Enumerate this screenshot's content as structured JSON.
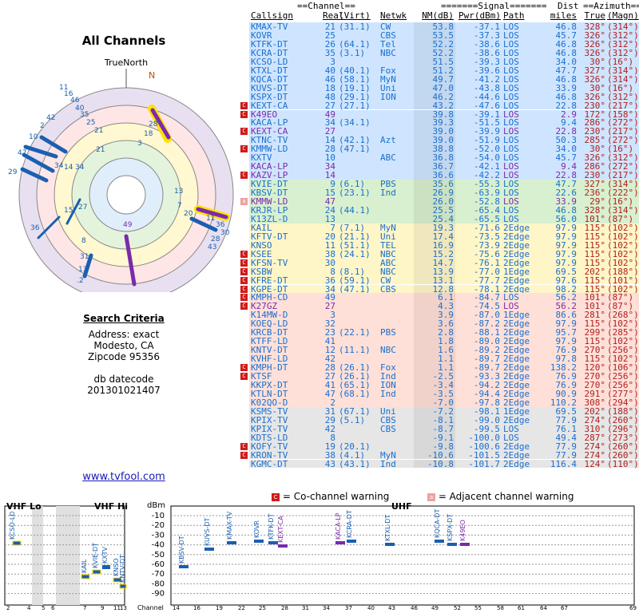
{
  "left": {
    "title": "All Channels",
    "north_label": "TrueNorth",
    "north_marker": "N"
  },
  "criteria": {
    "heading": "Search Criteria",
    "address": "Address: exact",
    "city": "Modesto, CA",
    "zip": "Zipcode 95356",
    "db_label": "db datecode",
    "db_value": "201301021407"
  },
  "site_link": "www.tvfool.com",
  "table": {
    "group_channel": "==Channel==",
    "group_signal": "=======Signal=======",
    "group_dist": "Dist",
    "group_azimuth": "==Azimuth==",
    "headers": [
      "Callsign",
      "Real",
      "(Virt)",
      "Netwk",
      "NM(dB)",
      "Pwr(dBm)",
      "Path",
      "miles",
      "True",
      "(Magn)"
    ],
    "rows": [
      {
        "cs": "KMAX-TV",
        "real": "21",
        "virt": "(31.1)",
        "net": "CW",
        "nm": "53.8",
        "pwr": "-37.1",
        "path": "LOS",
        "dist": "46.8",
        "az": "328°",
        "mag": "(314°)",
        "bg": "#cfe5ff",
        "col": "#1a6fcf",
        "w": ""
      },
      {
        "cs": "KOVR",
        "real": "25",
        "virt": "",
        "net": "CBS",
        "nm": "53.5",
        "pwr": "-37.3",
        "path": "LOS",
        "dist": "45.7",
        "az": "326°",
        "mag": "(312°)",
        "bg": "#cfe5ff",
        "col": "#1a6fcf",
        "w": ""
      },
      {
        "cs": "KTFK-DT",
        "real": "26",
        "virt": "(64.1)",
        "net": "Tel",
        "nm": "52.2",
        "pwr": "-38.6",
        "path": "LOS",
        "dist": "46.8",
        "az": "326°",
        "mag": "(312°)",
        "bg": "#cfe5ff",
        "col": "#1a6fcf",
        "w": ""
      },
      {
        "cs": "KCRA-DT",
        "real": "35",
        "virt": "(3.1)",
        "net": "NBC",
        "nm": "52.2",
        "pwr": "-38.6",
        "path": "LOS",
        "dist": "46.8",
        "az": "326°",
        "mag": "(312°)",
        "bg": "#cfe5ff",
        "col": "#1a6fcf",
        "w": ""
      },
      {
        "cs": "KCSO-LD",
        "real": "3",
        "virt": "",
        "net": "",
        "nm": "51.5",
        "pwr": "-39.3",
        "path": "LOS",
        "dist": "34.0",
        "az": "30°",
        "mag": "(16°)",
        "bg": "#cfe5ff",
        "col": "#1a6fcf",
        "w": ""
      },
      {
        "cs": "KTXL-DT",
        "real": "40",
        "virt": "(40.1)",
        "net": "Fox",
        "nm": "51.2",
        "pwr": "-39.6",
        "path": "LOS",
        "dist": "47.7",
        "az": "327°",
        "mag": "(314°)",
        "bg": "#cfe5ff",
        "col": "#1a6fcf",
        "w": ""
      },
      {
        "cs": "KQCA-DT",
        "real": "46",
        "virt": "(58.1)",
        "net": "MyN",
        "nm": "49.7",
        "pwr": "-41.2",
        "path": "LOS",
        "dist": "46.8",
        "az": "326°",
        "mag": "(314°)",
        "bg": "#cfe5ff",
        "col": "#1a6fcf",
        "w": ""
      },
      {
        "cs": "KUVS-DT",
        "real": "18",
        "virt": "(19.1)",
        "net": "Uni",
        "nm": "47.0",
        "pwr": "-43.8",
        "path": "LOS",
        "dist": "33.9",
        "az": "30°",
        "mag": "(16°)",
        "bg": "#cfe5ff",
        "col": "#1a6fcf",
        "w": ""
      },
      {
        "cs": "KSPX-DT",
        "real": "48",
        "virt": "(29.1)",
        "net": "ION",
        "nm": "46.2",
        "pwr": "-44.6",
        "path": "LOS",
        "dist": "46.8",
        "az": "326°",
        "mag": "(312°)",
        "bg": "#cfe5ff",
        "col": "#1a6fcf",
        "w": ""
      },
      {
        "cs": "KEXT-CA",
        "real": "27",
        "virt": "(27.1)",
        "net": "",
        "nm": "43.2",
        "pwr": "-47.6",
        "path": "LOS",
        "dist": "22.8",
        "az": "230°",
        "mag": "(217°)",
        "bg": "#cfe5ff",
        "col": "#1a6fcf",
        "w": "C"
      },
      {
        "cs": "K49EO",
        "real": "49",
        "virt": "",
        "net": "",
        "nm": "39.8",
        "pwr": "-39.1",
        "path": "LOS",
        "dist": "2.9",
        "az": "172°",
        "mag": "(158°)",
        "bg": "#cfe5ff",
        "col": "#7a2aaa",
        "w": "C"
      },
      {
        "cs": "KACA-LP",
        "real": "34",
        "virt": "(34.1)",
        "net": "",
        "nm": "39.3",
        "pwr": "-51.5",
        "path": "LOS",
        "dist": "9.4",
        "az": "286°",
        "mag": "(272°)",
        "bg": "#cfe5ff",
        "col": "#1a6fcf",
        "w": ""
      },
      {
        "cs": "KEXT-CA",
        "real": "27",
        "virt": "",
        "net": "",
        "nm": "39.0",
        "pwr": "-39.9",
        "path": "LOS",
        "dist": "22.8",
        "az": "230°",
        "mag": "(217°)",
        "bg": "#cfe5ff",
        "col": "#7a2aaa",
        "w": "C"
      },
      {
        "cs": "KTNC-TV",
        "real": "14",
        "virt": "(42.1)",
        "net": "Azt",
        "nm": "39.0",
        "pwr": "-51.9",
        "path": "LOS",
        "dist": "50.3",
        "az": "285°",
        "mag": "(272°)",
        "bg": "#cfe5ff",
        "col": "#1a6fcf",
        "w": ""
      },
      {
        "cs": "KMMW-LD",
        "real": "28",
        "virt": "(47.1)",
        "net": "",
        "nm": "38.8",
        "pwr": "-52.0",
        "path": "LOS",
        "dist": "34.0",
        "az": "30°",
        "mag": "(16°)",
        "bg": "#cfe5ff",
        "col": "#1a6fcf",
        "w": "C"
      },
      {
        "cs": "KXTV",
        "real": "10",
        "virt": "",
        "net": "ABC",
        "nm": "36.8",
        "pwr": "-54.0",
        "path": "LOS",
        "dist": "45.7",
        "az": "326°",
        "mag": "(312°)",
        "bg": "#cfe5ff",
        "col": "#1a6fcf",
        "w": ""
      },
      {
        "cs": "KACA-LP",
        "real": "34",
        "virt": "",
        "net": "",
        "nm": "36.7",
        "pwr": "-42.1",
        "path": "LOS",
        "dist": "9.4",
        "az": "286°",
        "mag": "(272°)",
        "bg": "#cfe5ff",
        "col": "#7a2aaa",
        "w": ""
      },
      {
        "cs": "KAZV-LP",
        "real": "14",
        "virt": "",
        "net": "",
        "nm": "36.6",
        "pwr": "-42.2",
        "path": "LOS",
        "dist": "22.8",
        "az": "230°",
        "mag": "(217°)",
        "bg": "#cfe5ff",
        "col": "#7a2aaa",
        "w": "C"
      },
      {
        "cs": "KVIE-DT",
        "real": "9",
        "virt": "(6.1)",
        "net": "PBS",
        "nm": "35.6",
        "pwr": "-55.3",
        "path": "LOS",
        "dist": "47.7",
        "az": "327°",
        "mag": "(314°)",
        "bg": "#d8f0cf",
        "col": "#1a6fcf",
        "w": ""
      },
      {
        "cs": "KBSV-DT",
        "real": "15",
        "virt": "(23.1)",
        "net": "Ind",
        "nm": "26.9",
        "pwr": "-63.9",
        "path": "LOS",
        "dist": "22.6",
        "az": "236°",
        "mag": "(222°)",
        "bg": "#d8f0cf",
        "col": "#1a6fcf",
        "w": ""
      },
      {
        "cs": "KMMW-LD",
        "real": "47",
        "virt": "",
        "net": "",
        "nm": "26.0",
        "pwr": "-52.8",
        "path": "LOS",
        "dist": "33.9",
        "az": "29°",
        "mag": "(16°)",
        "bg": "#d8f0cf",
        "col": "#7a2aaa",
        "w": "A"
      },
      {
        "cs": "KRJR-LP",
        "real": "24",
        "virt": "(44.1)",
        "net": "",
        "nm": "25.5",
        "pwr": "-65.4",
        "path": "LOS",
        "dist": "46.8",
        "az": "328°",
        "mag": "(314°)",
        "bg": "#d8f0cf",
        "col": "#1a6fcf",
        "w": ""
      },
      {
        "cs": "K13ZL-D",
        "real": "13",
        "virt": "",
        "net": "",
        "nm": "25.4",
        "pwr": "-65.5",
        "path": "LOS",
        "dist": "56.0",
        "az": "101°",
        "mag": "(87°)",
        "bg": "#d8f0cf",
        "col": "#1a6fcf",
        "w": ""
      },
      {
        "cs": "KAIL",
        "real": "7",
        "virt": "(7.1)",
        "net": "MyN",
        "nm": "19.3",
        "pwr": "-71.6",
        "path": "2Edge",
        "dist": "97.9",
        "az": "115°",
        "mag": "(102°)",
        "bg": "#fff6c8",
        "col": "#1a6fcf",
        "w": ""
      },
      {
        "cs": "KFTV-DT",
        "real": "20",
        "virt": "(21.1)",
        "net": "Uni",
        "nm": "17.4",
        "pwr": "-73.5",
        "path": "2Edge",
        "dist": "97.9",
        "az": "115°",
        "mag": "(102°)",
        "bg": "#fff6c8",
        "col": "#1a6fcf",
        "w": ""
      },
      {
        "cs": "KNSO",
        "real": "11",
        "virt": "(51.1)",
        "net": "TEL",
        "nm": "16.9",
        "pwr": "-73.9",
        "path": "2Edge",
        "dist": "97.9",
        "az": "115°",
        "mag": "(102°)",
        "bg": "#fff6c8",
        "col": "#1a6fcf",
        "w": ""
      },
      {
        "cs": "KSEE",
        "real": "38",
        "virt": "(24.1)",
        "net": "NBC",
        "nm": "15.2",
        "pwr": "-75.6",
        "path": "2Edge",
        "dist": "97.9",
        "az": "115°",
        "mag": "(102°)",
        "bg": "#fff6c8",
        "col": "#1a6fcf",
        "w": "C"
      },
      {
        "cs": "KFSN-TV",
        "real": "30",
        "virt": "",
        "net": "ABC",
        "nm": "14.7",
        "pwr": "-76.1",
        "path": "2Edge",
        "dist": "97.9",
        "az": "115°",
        "mag": "(102°)",
        "bg": "#fff6c8",
        "col": "#1a6fcf",
        "w": "C"
      },
      {
        "cs": "KSBW",
        "real": "8",
        "virt": "(8.1)",
        "net": "NBC",
        "nm": "13.9",
        "pwr": "-77.0",
        "path": "1Edge",
        "dist": "69.5",
        "az": "202°",
        "mag": "(188°)",
        "bg": "#fff6c8",
        "col": "#1a6fcf",
        "w": "C"
      },
      {
        "cs": "KFRE-DT",
        "real": "36",
        "virt": "(59.1)",
        "net": "CW",
        "nm": "13.1",
        "pwr": "-77.7",
        "path": "2Edge",
        "dist": "97.6",
        "az": "115°",
        "mag": "(101°)",
        "bg": "#fff6c8",
        "col": "#1a6fcf",
        "w": "C"
      },
      {
        "cs": "KGPE-DT",
        "real": "34",
        "virt": "(47.1)",
        "net": "CBS",
        "nm": "12.8",
        "pwr": "-78.1",
        "path": "2Edge",
        "dist": "98.2",
        "az": "115°",
        "mag": "(102°)",
        "bg": "#fff6c8",
        "col": "#1a6fcf",
        "w": "C"
      },
      {
        "cs": "KMPH-CD",
        "real": "49",
        "virt": "",
        "net": "",
        "nm": "6.1",
        "pwr": "-84.7",
        "path": "LOS",
        "dist": "56.2",
        "az": "101°",
        "mag": "(87°)",
        "bg": "#ffe0d8",
        "col": "#1a6fcf",
        "w": "C"
      },
      {
        "cs": "K27GZ",
        "real": "27",
        "virt": "",
        "net": "",
        "nm": "4.3",
        "pwr": "-74.5",
        "path": "LOS",
        "dist": "56.2",
        "az": "101°",
        "mag": "(87°)",
        "bg": "#ffe0d8",
        "col": "#7a2aaa",
        "w": "C"
      },
      {
        "cs": "K14MW-D",
        "real": "3",
        "virt": "",
        "net": "",
        "nm": "3.9",
        "pwr": "-87.0",
        "path": "1Edge",
        "dist": "86.6",
        "az": "281°",
        "mag": "(268°)",
        "bg": "#ffe0d8",
        "col": "#1a6fcf",
        "w": ""
      },
      {
        "cs": "KOEQ-LD",
        "real": "32",
        "virt": "",
        "net": "",
        "nm": "3.6",
        "pwr": "-87.2",
        "path": "2Edge",
        "dist": "97.9",
        "az": "115°",
        "mag": "(102°)",
        "bg": "#ffe0d8",
        "col": "#1a6fcf",
        "w": ""
      },
      {
        "cs": "KRCB-DT",
        "real": "23",
        "virt": "(22.1)",
        "net": "PBS",
        "nm": "2.8",
        "pwr": "-88.1",
        "path": "2Edge",
        "dist": "95.7",
        "az": "299°",
        "mag": "(285°)",
        "bg": "#ffe0d8",
        "col": "#1a6fcf",
        "w": ""
      },
      {
        "cs": "KTFF-LD",
        "real": "41",
        "virt": "",
        "net": "",
        "nm": "1.8",
        "pwr": "-89.0",
        "path": "2Edge",
        "dist": "97.9",
        "az": "115°",
        "mag": "(102°)",
        "bg": "#ffe0d8",
        "col": "#1a6fcf",
        "w": ""
      },
      {
        "cs": "KNTV-DT",
        "real": "12",
        "virt": "(11.1)",
        "net": "NBC",
        "nm": "1.6",
        "pwr": "-89.2",
        "path": "2Edge",
        "dist": "76.9",
        "az": "270°",
        "mag": "(256°)",
        "bg": "#ffe0d8",
        "col": "#1a6fcf",
        "w": ""
      },
      {
        "cs": "KVHF-LD",
        "real": "42",
        "virt": "",
        "net": "",
        "nm": "1.1",
        "pwr": "-89.7",
        "path": "2Edge",
        "dist": "97.8",
        "az": "115°",
        "mag": "(102°)",
        "bg": "#ffe0d8",
        "col": "#1a6fcf",
        "w": ""
      },
      {
        "cs": "KMPH-DT",
        "real": "28",
        "virt": "(26.1)",
        "net": "Fox",
        "nm": "1.1",
        "pwr": "-89.7",
        "path": "2Edge",
        "dist": "138.2",
        "az": "120°",
        "mag": "(106°)",
        "bg": "#ffe0d8",
        "col": "#1a6fcf",
        "w": "C"
      },
      {
        "cs": "KTSF",
        "real": "27",
        "virt": "(26.1)",
        "net": "Ind",
        "nm": "-2.5",
        "pwr": "-93.3",
        "path": "2Edge",
        "dist": "76.9",
        "az": "270°",
        "mag": "(256°)",
        "bg": "#ffe0d8",
        "col": "#1a6fcf",
        "w": "C"
      },
      {
        "cs": "KKPX-DT",
        "real": "41",
        "virt": "(65.1)",
        "net": "ION",
        "nm": "-3.4",
        "pwr": "-94.2",
        "path": "2Edge",
        "dist": "76.9",
        "az": "270°",
        "mag": "(256°)",
        "bg": "#ffe0d8",
        "col": "#1a6fcf",
        "w": ""
      },
      {
        "cs": "KTLN-DT",
        "real": "47",
        "virt": "(68.1)",
        "net": "Ind",
        "nm": "-3.5",
        "pwr": "-94.4",
        "path": "2Edge",
        "dist": "90.9",
        "az": "291°",
        "mag": "(277°)",
        "bg": "#ffe0d8",
        "col": "#1a6fcf",
        "w": ""
      },
      {
        "cs": "K02QO-D",
        "real": "2",
        "virt": "",
        "net": "",
        "nm": "-7.0",
        "pwr": "-97.8",
        "path": "2Edge",
        "dist": "110.2",
        "az": "308°",
        "mag": "(294°)",
        "bg": "#ffe0d8",
        "col": "#1a6fcf",
        "w": ""
      },
      {
        "cs": "KSMS-TV",
        "real": "31",
        "virt": "(67.1)",
        "net": "Uni",
        "nm": "-7.2",
        "pwr": "-98.1",
        "path": "1Edge",
        "dist": "69.5",
        "az": "202°",
        "mag": "(188°)",
        "bg": "#e6e6e6",
        "col": "#1a6fcf",
        "w": ""
      },
      {
        "cs": "KPIX-TV",
        "real": "29",
        "virt": "(5.1)",
        "net": "CBS",
        "nm": "-8.1",
        "pwr": "-99.0",
        "path": "2Edge",
        "dist": "77.9",
        "az": "274°",
        "mag": "(260°)",
        "bg": "#e6e6e6",
        "col": "#1a6fcf",
        "w": ""
      },
      {
        "cs": "KPIX-TV",
        "real": "42",
        "virt": "",
        "net": "CBS",
        "nm": "-8.7",
        "pwr": "-99.5",
        "path": "LOS",
        "dist": "76.1",
        "az": "310°",
        "mag": "(296°)",
        "bg": "#e6e6e6",
        "col": "#1a6fcf",
        "w": ""
      },
      {
        "cs": "KDTS-LD",
        "real": "8",
        "virt": "",
        "net": "",
        "nm": "-9.1",
        "pwr": "-100.0",
        "path": "LOS",
        "dist": "49.4",
        "az": "287°",
        "mag": "(273°)",
        "bg": "#e6e6e6",
        "col": "#1a6fcf",
        "w": ""
      },
      {
        "cs": "KOFY-TV",
        "real": "19",
        "virt": "(20.1)",
        "net": "",
        "nm": "-9.8",
        "pwr": "-100.6",
        "path": "2Edge",
        "dist": "77.9",
        "az": "274°",
        "mag": "(260°)",
        "bg": "#e6e6e6",
        "col": "#1a6fcf",
        "w": "C"
      },
      {
        "cs": "KRON-TV",
        "real": "38",
        "virt": "(4.1)",
        "net": "MyN",
        "nm": "-10.6",
        "pwr": "-101.5",
        "path": "2Edge",
        "dist": "77.9",
        "az": "274°",
        "mag": "(260°)",
        "bg": "#e6e6e6",
        "col": "#1a6fcf",
        "w": "C"
      },
      {
        "cs": "KGMC-DT",
        "real": "43",
        "virt": "(43.1)",
        "net": "Ind",
        "nm": "-10.8",
        "pwr": "-101.7",
        "path": "2Edge",
        "dist": "116.4",
        "az": "124°",
        "mag": "(110°)",
        "bg": "#e6e6e6",
        "col": "#1a6fcf",
        "w": ""
      }
    ]
  },
  "legend": {
    "co_mark": "C",
    "co_text": "= Co-channel warning",
    "adj_mark": "a",
    "adj_text": "= Adjacent channel warning"
  },
  "spectrum": {
    "vhf_lo": "VHF Lo",
    "vhf_hi": "VHF Hi",
    "uhf": "UHF",
    "dbm_label": "dBm",
    "channel_label": "Channel",
    "dbm_ticks": [
      "-10",
      "-20",
      "-30",
      "-40",
      "-50",
      "-60",
      "-70",
      "-80",
      "-90"
    ],
    "ch_ticks": [
      "2",
      "4",
      "5",
      "6",
      "7",
      "9",
      "11",
      "13",
      "14",
      "16",
      "19",
      "22",
      "25",
      "28",
      "31",
      "34",
      "37",
      "40",
      "43",
      "46",
      "49",
      "52",
      "55",
      "58",
      "61",
      "64",
      "67",
      "69"
    ]
  }
}
